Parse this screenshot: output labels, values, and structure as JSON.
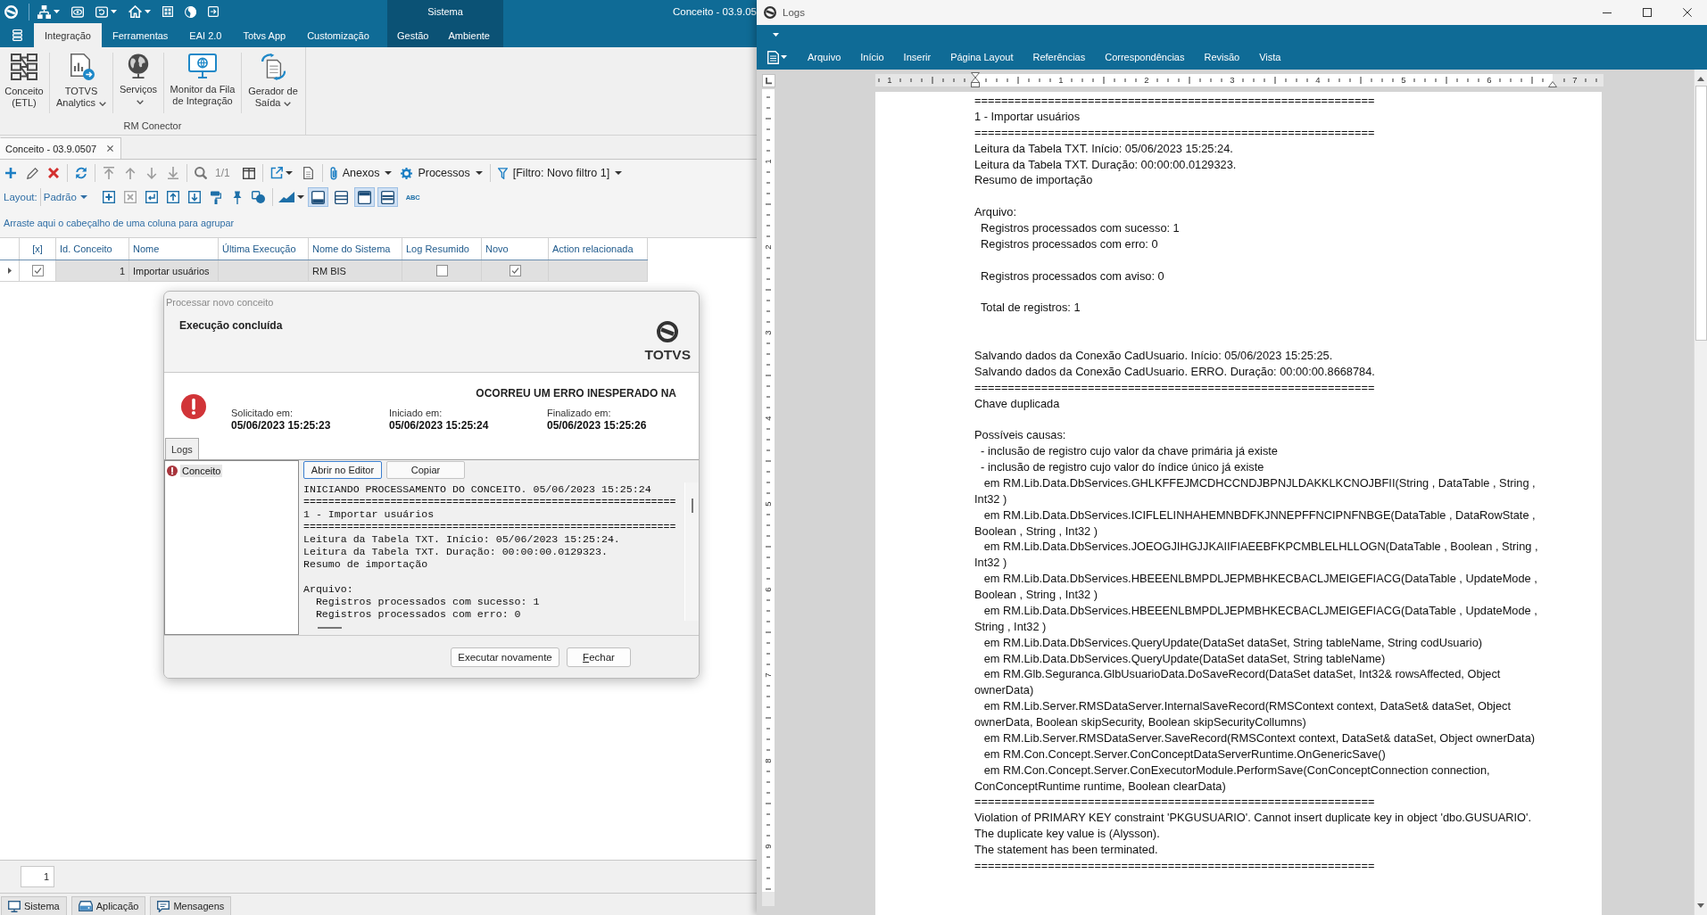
{
  "app_window": {
    "title": "Conceito - 03.9.05",
    "context_group": "Sistema",
    "quick_access": [
      {
        "has_menu": true
      },
      {
        "has_menu": false
      },
      {
        "has_menu": true
      },
      {
        "has_menu": true
      },
      {
        "has_menu": false
      },
      {
        "has_menu": false
      },
      {
        "has_menu": false
      }
    ],
    "ribbon_tabs": [
      {
        "label": "Integração",
        "selected": true,
        "contextual": false
      },
      {
        "label": "Ferramentas",
        "selected": false,
        "contextual": false
      },
      {
        "label": "EAI 2.0",
        "selected": false,
        "contextual": false
      },
      {
        "label": "Totvs App",
        "selected": false,
        "contextual": false
      },
      {
        "label": "Customização",
        "selected": false,
        "contextual": false
      },
      {
        "label": "Gestão",
        "selected": false,
        "contextual": true
      },
      {
        "label": "Ambiente",
        "selected": false,
        "contextual": true
      }
    ],
    "ribbon_group": {
      "label": "RM Conector",
      "buttons": [
        {
          "label": "Conceito (ETL)",
          "has_menu": false
        },
        {
          "label": "TOTVS Analytics",
          "has_menu": true
        },
        {
          "label": "Serviços",
          "has_menu": true
        },
        {
          "label": "Monitor da Fila de Integração",
          "has_menu": false
        },
        {
          "label": "Gerador de Saída",
          "has_menu": true
        }
      ]
    },
    "document_tabs": [
      {
        "label": "Conceito - 03.9.0507",
        "selected": true
      }
    ],
    "toolbar": {
      "navigation_disabled": true,
      "record_counter": "1/1",
      "menus": [
        {
          "label": "Anexos"
        },
        {
          "label": "Processos"
        },
        {
          "label": "[Filtro: Novo filtro 1]"
        }
      ]
    },
    "layout_bar": {
      "label": "Layout:",
      "value": "Padrão",
      "remove_disabled": true,
      "view_toggles": [
        {
          "selected": true
        },
        {
          "selected": false
        },
        {
          "selected": true
        },
        {
          "selected": true
        }
      ],
      "spell_check": "ABC"
    },
    "group_panel_hint": "Arraste aqui o cabeçalho de uma coluna para agrupar",
    "table": {
      "columns": [
        "[x]",
        "Id. Conceito",
        "Nome",
        "Última Execução",
        "Nome do Sistema",
        "Log Resumido",
        "Novo",
        "Action relacionada"
      ],
      "rows": [
        {
          "selected": true,
          "checked": true,
          "id_conceito": "1",
          "nome": "Importar usuários",
          "nome_do_sistema": "RM BIS",
          "log_resumido": false,
          "novo": true
        }
      ]
    },
    "pager": {
      "value": "1"
    },
    "status_tabs": [
      {
        "label": "Sistema"
      },
      {
        "label": "Aplicação"
      },
      {
        "label": "Mensagens"
      }
    ]
  },
  "dialog": {
    "title": "Processar novo conceito",
    "heading": "Execução concluída",
    "logo_text": "TOTVS",
    "result": {
      "kind": "error",
      "message": "OCORREU UM ERRO INESPERADO NA"
    },
    "times": [
      {
        "label": "Solicitado em:",
        "value": "05/06/2023 15:25:23"
      },
      {
        "label": "Iniciado em:",
        "value": "05/06/2023 15:25:24"
      },
      {
        "label": "Finalizado em:",
        "value": "05/06/2023 15:25:26"
      }
    ],
    "tabs": [
      {
        "label": "Logs",
        "selected": true
      }
    ],
    "tree": [
      {
        "label": "Conceito",
        "kind": "error",
        "selected": true
      }
    ],
    "log_buttons": [
      {
        "label": "Abrir no Editor",
        "focused": true
      },
      {
        "label": "Copiar",
        "focused": false
      }
    ],
    "log_lines": [
      {
        "kind": "text",
        "text": "INICIANDO PROCESSAMENTO DO CONCEITO. 05/06/2023 15:25:24"
      },
      {
        "kind": "text",
        "text": "============================================================"
      },
      {
        "kind": "text",
        "text": "1 - Importar usuários"
      },
      {
        "kind": "text",
        "text": "============================================================"
      },
      {
        "kind": "text",
        "text": "Leitura da Tabela TXT. Início: 05/06/2023 15:25:24."
      },
      {
        "kind": "text",
        "text": "Leitura da Tabela TXT. Duração: 00:00:00.0129323."
      },
      {
        "kind": "text",
        "text": "Resumo de importação"
      },
      {
        "kind": "blank"
      },
      {
        "kind": "text",
        "text": "Arquivo:"
      },
      {
        "kind": "text",
        "text": "  Registros processados com sucesso: 1"
      },
      {
        "kind": "text",
        "text": "  Registros processados com erro: 0"
      }
    ],
    "buttons": [
      {
        "label": "Executar novamente",
        "mnemonic": false
      },
      {
        "label": "Fechar",
        "mnemonic": true
      }
    ]
  },
  "word_window": {
    "title": "Logs",
    "menu_tabs": [
      {
        "label": "Arquivo",
        "selected": false
      },
      {
        "label": "Início",
        "selected": false
      },
      {
        "label": "Inserir",
        "selected": false
      },
      {
        "label": "Página Layout",
        "selected": false
      },
      {
        "label": "Referências",
        "selected": false
      },
      {
        "label": "Correspondências",
        "selected": false
      },
      {
        "label": "Revisão",
        "selected": false
      },
      {
        "label": "Vista",
        "selected": false
      }
    ],
    "ruler": {
      "labels": [
        "1",
        "1",
        "2",
        "3",
        "4",
        "5",
        "6",
        "7"
      ]
    },
    "vertical_ruler": {
      "labels": [
        "1",
        "2",
        "3",
        "4",
        "5",
        "6",
        "7",
        "8",
        "9"
      ]
    },
    "document": {
      "lines": [
        {
          "kind": "text",
          "text": "============================================================"
        },
        {
          "kind": "text",
          "text": "1 - Importar usuários"
        },
        {
          "kind": "text",
          "text": "============================================================"
        },
        {
          "kind": "text",
          "text": "Leitura da Tabela TXT. Início: 05/06/2023 15:25:24."
        },
        {
          "kind": "text",
          "text": "Leitura da Tabela TXT. Duração: 00:00:00.0129323."
        },
        {
          "kind": "text",
          "text": "Resumo de importação"
        },
        {
          "kind": "blank"
        },
        {
          "kind": "text",
          "text": "Arquivo:"
        },
        {
          "kind": "text",
          "text": "  Registros processados com sucesso: 1"
        },
        {
          "kind": "text",
          "text": "  Registros processados com erro: 0"
        },
        {
          "kind": "blank"
        },
        {
          "kind": "text",
          "text": "  Registros processados com aviso: 0"
        },
        {
          "kind": "blank"
        },
        {
          "kind": "text",
          "text": "  Total de registros: 1"
        },
        {
          "kind": "blank"
        },
        {
          "kind": "blank"
        },
        {
          "kind": "text",
          "text": "Salvando dados da Conexão CadUsuario. Início: 05/06/2023 15:25:25."
        },
        {
          "kind": "text",
          "text": "Salvando dados da Conexão CadUsuario. ERRO. Duração: 00:00:00.8668784."
        },
        {
          "kind": "text",
          "text": "============================================================"
        },
        {
          "kind": "text",
          "text": "Chave duplicada"
        },
        {
          "kind": "blank"
        },
        {
          "kind": "text",
          "text": "Possíveis causas:"
        },
        {
          "kind": "text",
          "text": "  - inclusão de registro cujo valor da chave primária já existe"
        },
        {
          "kind": "text",
          "text": "  - inclusão de registro cujo valor do índice único já existe"
        },
        {
          "kind": "text",
          "text": "   em RM.Lib.Data.DbServices.GHLKFFEJMCDHCCNDJBPNJLDAKKLKCNOJBFII(String , DataTable , String ,\nInt32 )"
        },
        {
          "kind": "text",
          "text": "   em RM.Lib.Data.DbServices.ICIFLELINHAHEMNBDFKJNNEPFFNCIPNFNBGE(DataTable , DataRowState ,\nBoolean , String , Int32 )"
        },
        {
          "kind": "text",
          "text": "   em RM.Lib.Data.DbServices.JOEOGJIHGJJKAIIFIAEEBFKPCMBLELHLLOGN(DataTable , Boolean , String ,\nInt32 )"
        },
        {
          "kind": "text",
          "text": "   em RM.Lib.Data.DbServices.HBEEENLBMPDLJEPMBHKECBACLJMEIGEFIACG(DataTable , UpdateMode ,\nBoolean , String , Int32 )"
        },
        {
          "kind": "text",
          "text": "   em RM.Lib.Data.DbServices.HBEEENLBMPDLJEPMBHKECBACLJMEIGEFIACG(DataTable , UpdateMode ,\nString , Int32 )"
        },
        {
          "kind": "text",
          "text": "   em RM.Lib.Data.DbServices.QueryUpdate(DataSet dataSet, String tableName, String codUsuario)"
        },
        {
          "kind": "text",
          "text": "   em RM.Lib.Data.DbServices.QueryUpdate(DataSet dataSet, String tableName)"
        },
        {
          "kind": "text",
          "text": "   em RM.Glb.Seguranca.GlbUsuarioData.DoSaveRecord(DataSet dataSet, Int32& rowsAffected, Object\nownerData)"
        },
        {
          "kind": "text",
          "text": "   em RM.Lib.Server.RMSDataServer.InternalSaveRecord(RMSContext context, DataSet& dataSet, Object\nownerData, Boolean skipSecurity, Boolean skipSecurityCollumns)"
        },
        {
          "kind": "text",
          "text": "   em RM.Lib.Server.RMSDataServer.SaveRecord(RMSContext context, DataSet& dataSet, Object ownerData)"
        },
        {
          "kind": "text",
          "text": "   em RM.Con.Concept.Server.ConConceptDataServerRuntime.OnGenericSave()"
        },
        {
          "kind": "text",
          "text": "   em RM.Con.Concept.Server.ConExecutorModule.PerformSave(ConConceptConnection connection,\nConConceptRuntime runtime, Boolean clearData)"
        },
        {
          "kind": "text",
          "text": "============================================================"
        },
        {
          "kind": "text",
          "text": "Violation of PRIMARY KEY constraint 'PKGUSUARIO'. Cannot insert duplicate key in object 'dbo.GUSUARIO'."
        },
        {
          "kind": "text",
          "text": "The duplicate key value is (Alysson)."
        },
        {
          "kind": "text",
          "text": "The statement has been terminated."
        },
        {
          "kind": "text",
          "text": "============================================================"
        }
      ]
    }
  }
}
